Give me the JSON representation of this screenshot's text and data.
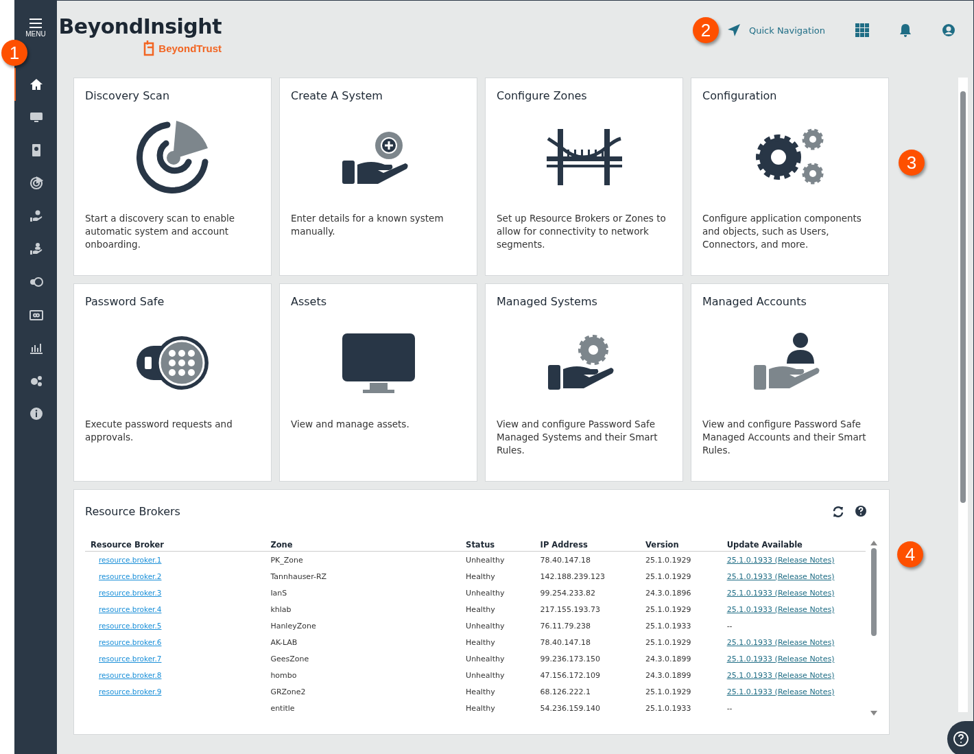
{
  "sidebar": {
    "menu_label": "MENU",
    "items": [
      {
        "selected": true
      },
      {
        "selected": false
      },
      {
        "selected": false
      },
      {
        "selected": false
      },
      {
        "selected": false
      },
      {
        "selected": false
      },
      {
        "selected": false
      },
      {
        "selected": false
      },
      {
        "selected": false
      },
      {
        "selected": false
      },
      {
        "selected": false
      }
    ]
  },
  "header": {
    "title": "BeyondInsight",
    "brand": "BeyondTrust",
    "quick_nav": "Quick Navigation"
  },
  "cards": [
    {
      "title": "Discovery Scan",
      "description": "Start a discovery scan to enable automatic system and account onboarding."
    },
    {
      "title": "Create A System",
      "description": "Enter details for a known system manually."
    },
    {
      "title": "Configure Zones",
      "description": "Set up Resource Brokers or Zones to allow for connectivity to network segments."
    },
    {
      "title": "Configuration",
      "description": "Configure application components and objects, such as Users, Connectors, and more."
    },
    {
      "title": "Password Safe",
      "description": "Execute password requests and approvals."
    },
    {
      "title": "Assets",
      "description": "View and manage assets."
    },
    {
      "title": "Managed Systems",
      "description": "View and configure Password Safe Managed Systems and their Smart Rules."
    },
    {
      "title": "Managed Accounts",
      "description": "View and configure Password Safe Managed Accounts and their Smart Rules."
    }
  ],
  "resource_brokers": {
    "title": "Resource Brokers",
    "columns": [
      "Resource Broker",
      "Zone",
      "Status",
      "IP Address",
      "Version",
      "Update Available"
    ],
    "rows": [
      {
        "broker": "resource.broker.1",
        "zone": "PK_Zone",
        "status": "Unhealthy",
        "ip": "78.40.147.18",
        "version": "25.1.0.1929",
        "update": {
          "kind": "link",
          "text": "25.1.0.1933 (Release Notes)"
        }
      },
      {
        "broker": "resource.broker.2",
        "zone": "Tannhauser-RZ",
        "status": "Healthy",
        "ip": "142.188.239.123",
        "version": "25.1.0.1929",
        "update": {
          "kind": "link",
          "text": "25.1.0.1933 (Release Notes)"
        }
      },
      {
        "broker": "resource.broker.3",
        "zone": "IanS",
        "status": "Unhealthy",
        "ip": "99.254.233.82",
        "version": "24.3.0.1896",
        "update": {
          "kind": "link",
          "text": "25.1.0.1933 (Release Notes)"
        }
      },
      {
        "broker": "resource.broker.4",
        "zone": "khlab",
        "status": "Healthy",
        "ip": "217.155.193.73",
        "version": "25.1.0.1929",
        "update": {
          "kind": "link",
          "text": "25.1.0.1933 (Release Notes)"
        }
      },
      {
        "broker": "resource.broker.5",
        "zone": "HanleyZone",
        "status": "Unhealthy",
        "ip": "76.11.79.238",
        "version": "25.1.0.1933",
        "update": {
          "kind": "text",
          "text": "--"
        }
      },
      {
        "broker": "resource.broker.6",
        "zone": "AK-LAB",
        "status": "Healthy",
        "ip": "78.40.147.18",
        "version": "25.1.0.1929",
        "update": {
          "kind": "link",
          "text": "25.1.0.1933 (Release Notes)"
        }
      },
      {
        "broker": "resource.broker.7",
        "zone": "GeesZone",
        "status": "Unhealthy",
        "ip": "99.236.173.150",
        "version": "24.3.0.1899",
        "update": {
          "kind": "link",
          "text": "25.1.0.1933 (Release Notes)"
        }
      },
      {
        "broker": "resource.broker.8",
        "zone": "hombo",
        "status": "Unhealthy",
        "ip": "47.156.172.109",
        "version": "24.3.0.1899",
        "update": {
          "kind": "link",
          "text": "25.1.0.1933 (Release Notes)"
        }
      },
      {
        "broker": "resource.broker.9",
        "zone": "GRZone2",
        "status": "Healthy",
        "ip": "68.126.222.1",
        "version": "25.1.0.1929",
        "update": {
          "kind": "link",
          "text": "25.1.0.1933 (Release Notes)"
        }
      },
      {
        "zone": "entitle",
        "status": "Healthy",
        "ip": "54.236.159.140",
        "version": "25.1.0.1933",
        "update": {
          "kind": "text",
          "text": "--"
        }
      }
    ]
  },
  "callouts": [
    "1",
    "2",
    "3",
    "4"
  ]
}
